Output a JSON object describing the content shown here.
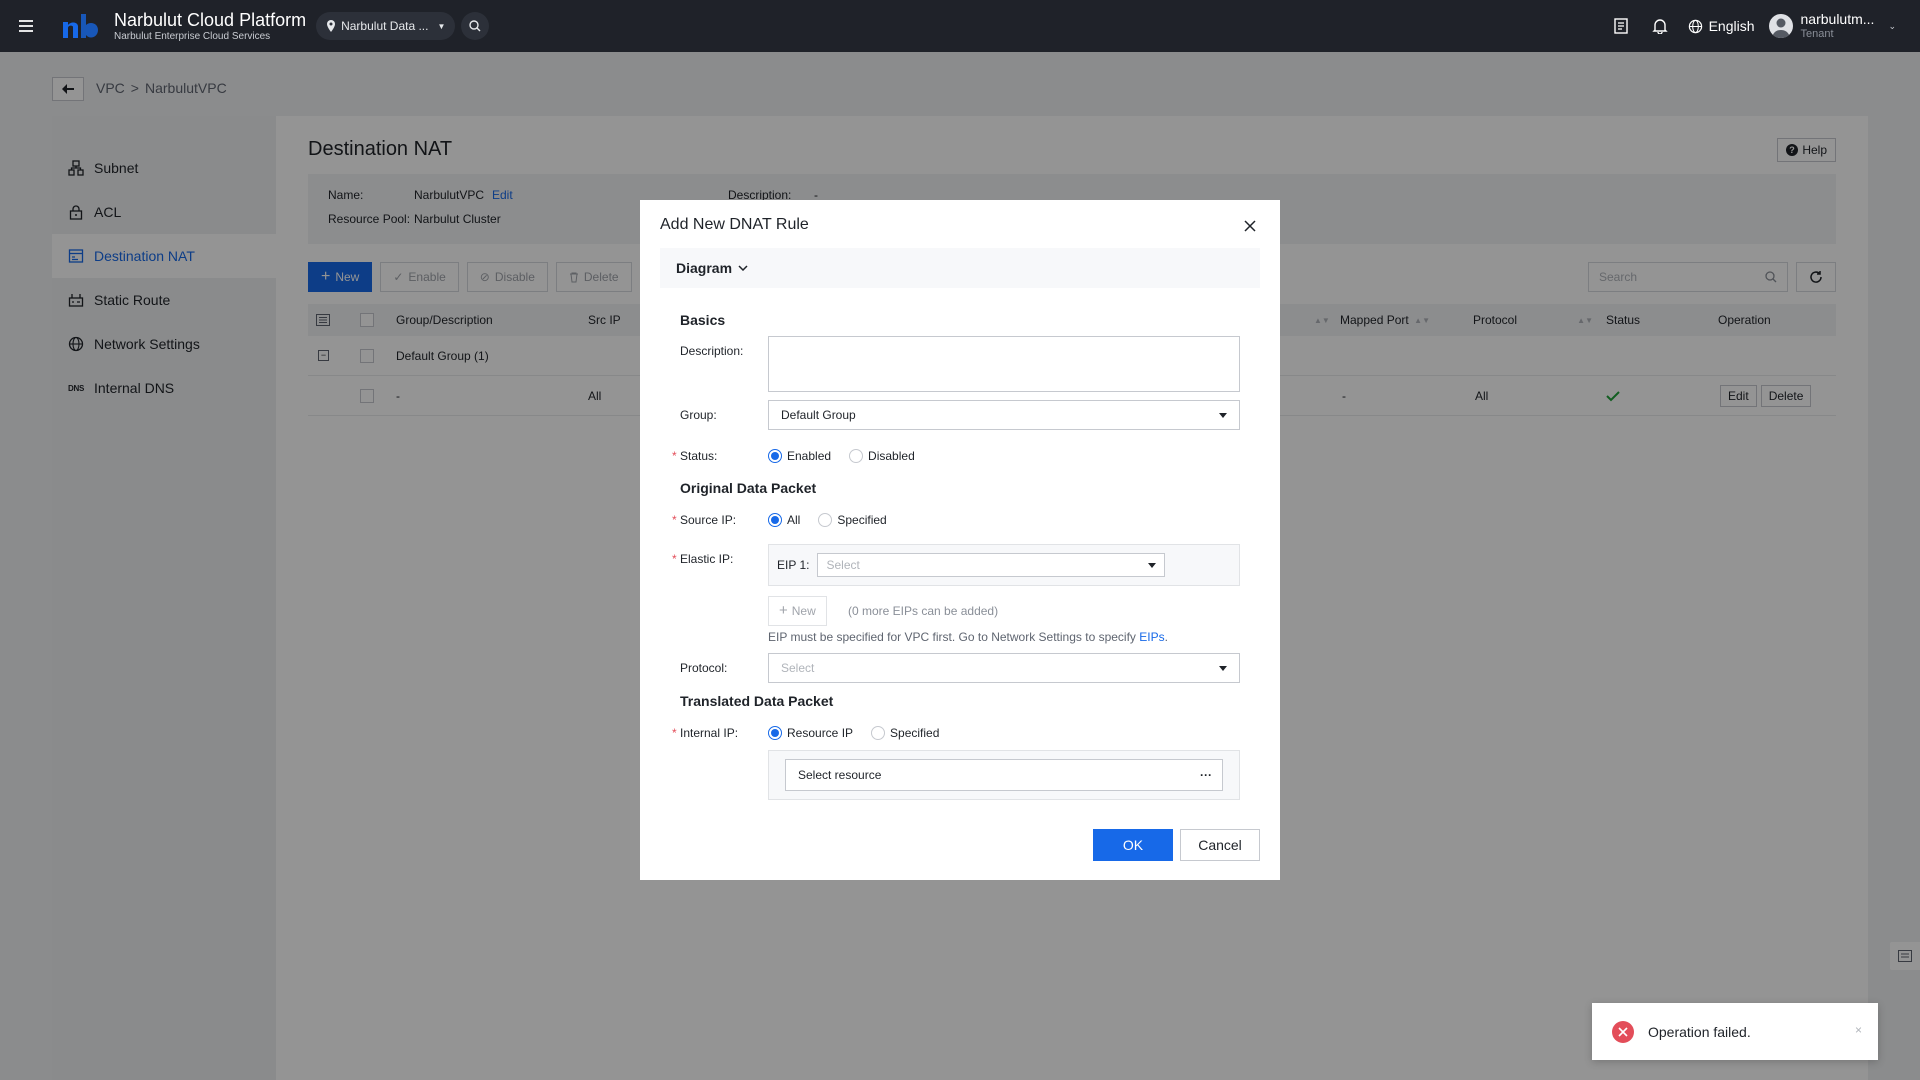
{
  "topbar": {
    "brand_title": "Narbulut Cloud Platform",
    "brand_sub": "Narbulut Enterprise Cloud Services",
    "region": "Narbulut Data ...",
    "language": "English",
    "user_name": "narbulutm...",
    "user_role": "Tenant"
  },
  "breadcrumb": {
    "root": "VPC",
    "separator": ">",
    "current": "NarbulutVPC"
  },
  "sidebar": {
    "items": [
      {
        "label": "Subnet",
        "icon": "subnet-icon"
      },
      {
        "label": "ACL",
        "icon": "lock-icon"
      },
      {
        "label": "Destination NAT",
        "icon": "nat-icon",
        "active": true
      },
      {
        "label": "Static Route",
        "icon": "route-icon"
      },
      {
        "label": "Network Settings",
        "icon": "globe-icon"
      },
      {
        "label": "Internal DNS",
        "icon": "dns-icon",
        "icon_text": "DNS"
      }
    ]
  },
  "main": {
    "title": "Destination NAT",
    "help": "Help",
    "info": {
      "name_label": "Name:",
      "name_value": "NarbulutVPC",
      "edit_link": "Edit",
      "pool_label": "Resource Pool:",
      "pool_value": "Narbulut Cluster",
      "desc_label": "Description:",
      "desc_value": "-"
    },
    "toolbar": {
      "new": "New",
      "enable": "Enable",
      "disable": "Disable",
      "delete": "Delete",
      "search_placeholder": "Search"
    },
    "table": {
      "columns": [
        "Group/Description",
        "Src IP",
        "Mapped Port",
        "Protocol",
        "Status",
        "Operation"
      ],
      "group_row": {
        "label": "Default Group (1)"
      },
      "data_row": {
        "description": "-",
        "src_ip": "All",
        "mapped_port": "-",
        "protocol": "All",
        "edit": "Edit",
        "delete": "Delete"
      }
    }
  },
  "modal": {
    "title": "Add New DNAT Rule",
    "diagram": "Diagram",
    "basics": "Basics",
    "description_label": "Description:",
    "group_label": "Group:",
    "group_value": "Default Group",
    "status_label": "Status:",
    "status_enabled": "Enabled",
    "status_disabled": "Disabled",
    "original": "Original Data Packet",
    "source_ip_label": "Source IP:",
    "source_all": "All",
    "source_specified": "Specified",
    "elastic_ip_label": "Elastic IP:",
    "eip1_label": "EIP 1:",
    "eip_placeholder": "Select",
    "eip_new": "New",
    "eip_note": "(0 more EIPs can be added)",
    "eip_hint": "EIP must be specified for VPC first. Go to Network Settings to specify",
    "eip_hint_link": "EIPs",
    "eip_hint_end": ".",
    "protocol_label": "Protocol:",
    "protocol_placeholder": "Select",
    "translated": "Translated Data Packet",
    "internal_ip_label": "Internal IP:",
    "internal_resource": "Resource IP",
    "internal_specified": "Specified",
    "select_resource": "Select resource",
    "more": "···",
    "ok": "OK",
    "cancel": "Cancel",
    "required_mark": "*"
  },
  "toast": {
    "message": "Operation failed.",
    "close": "×"
  },
  "colors": {
    "primary": "#1769e8",
    "topbar": "#1f2229",
    "error": "#e34d59",
    "success": "#1fa33a"
  }
}
